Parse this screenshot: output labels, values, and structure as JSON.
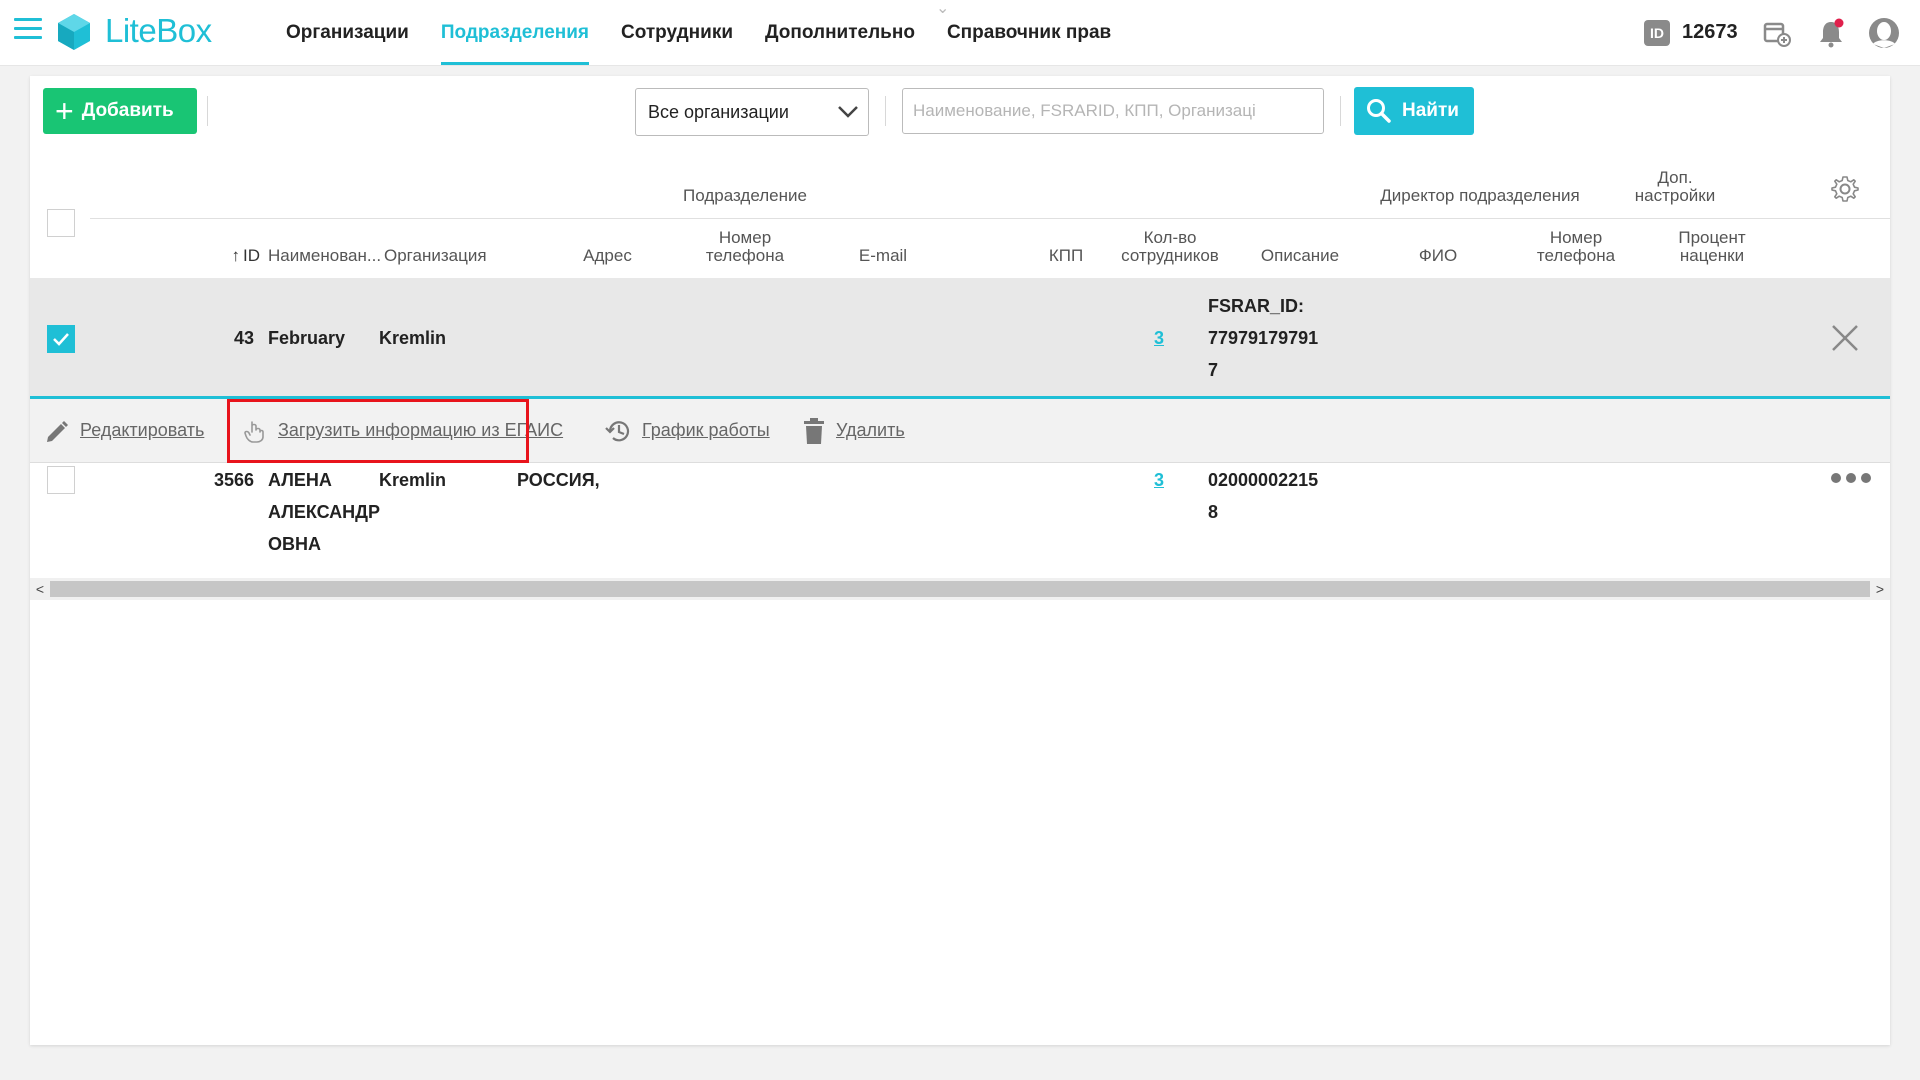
{
  "header": {
    "logo_text": "LiteBox",
    "nav": [
      {
        "label": "Организации"
      },
      {
        "label": "Подразделения",
        "active": true
      },
      {
        "label": "Сотрудники"
      },
      {
        "label": "Дополнительно"
      },
      {
        "label": "Справочник прав"
      }
    ],
    "id_badge": "ID",
    "id_number": "12673",
    "icons": [
      "menu-icon",
      "calendar-add-icon",
      "bell-icon",
      "user-avatar-icon"
    ],
    "accent_color": "#1fbfd6",
    "notification_dot_color": "#e0204c"
  },
  "toolbar": {
    "add_label": "Добавить",
    "org_select_value": "Все организации",
    "search_placeholder": "Наименование, FSRARID, КПП, Организаці",
    "search_value": "",
    "find_label": "Найти",
    "add_color": "#19c574"
  },
  "table": {
    "group_headers": {
      "division": "Подразделение",
      "director": "Директор подразделения",
      "extra_line1": "Доп.",
      "extra_line2": "настройки"
    },
    "columns": {
      "id": "ID",
      "name": "Наименован...",
      "org": "Организация",
      "address": "Адрес",
      "phone_line1": "Номер",
      "phone_line2": "телефона",
      "email": "E-mail",
      "kpp": "КПП",
      "count_line1": "Кол-во",
      "count_line2": "сотрудников",
      "description": "Описание",
      "fio": "ФИО",
      "dir_phone_line1": "Номер",
      "dir_phone_line2": "телефона",
      "markup_line1": "Процент",
      "markup_line2": "наценки"
    },
    "rows": [
      {
        "id": "43",
        "name": "February",
        "org": "Kremlin",
        "count": "3",
        "desc_line1": "FSRAR_ID:",
        "desc_line2": "77979179791",
        "desc_line3": "7",
        "selected": true
      },
      {
        "id": "3566",
        "name_line1": "АЛЕНА",
        "name_line2": "АЛЕКСАНДР",
        "name_line3": "ОВНА",
        "org": "Kremlin",
        "address": "РОССИЯ,",
        "count": "3",
        "desc_line1": "02000002215",
        "desc_line2": "8",
        "selected": false
      }
    ],
    "row_actions": {
      "edit": "Редактировать",
      "load_egais": "Загрузить информацию из ЕГАИС",
      "schedule": "График работы",
      "delete": "Удалить"
    }
  }
}
